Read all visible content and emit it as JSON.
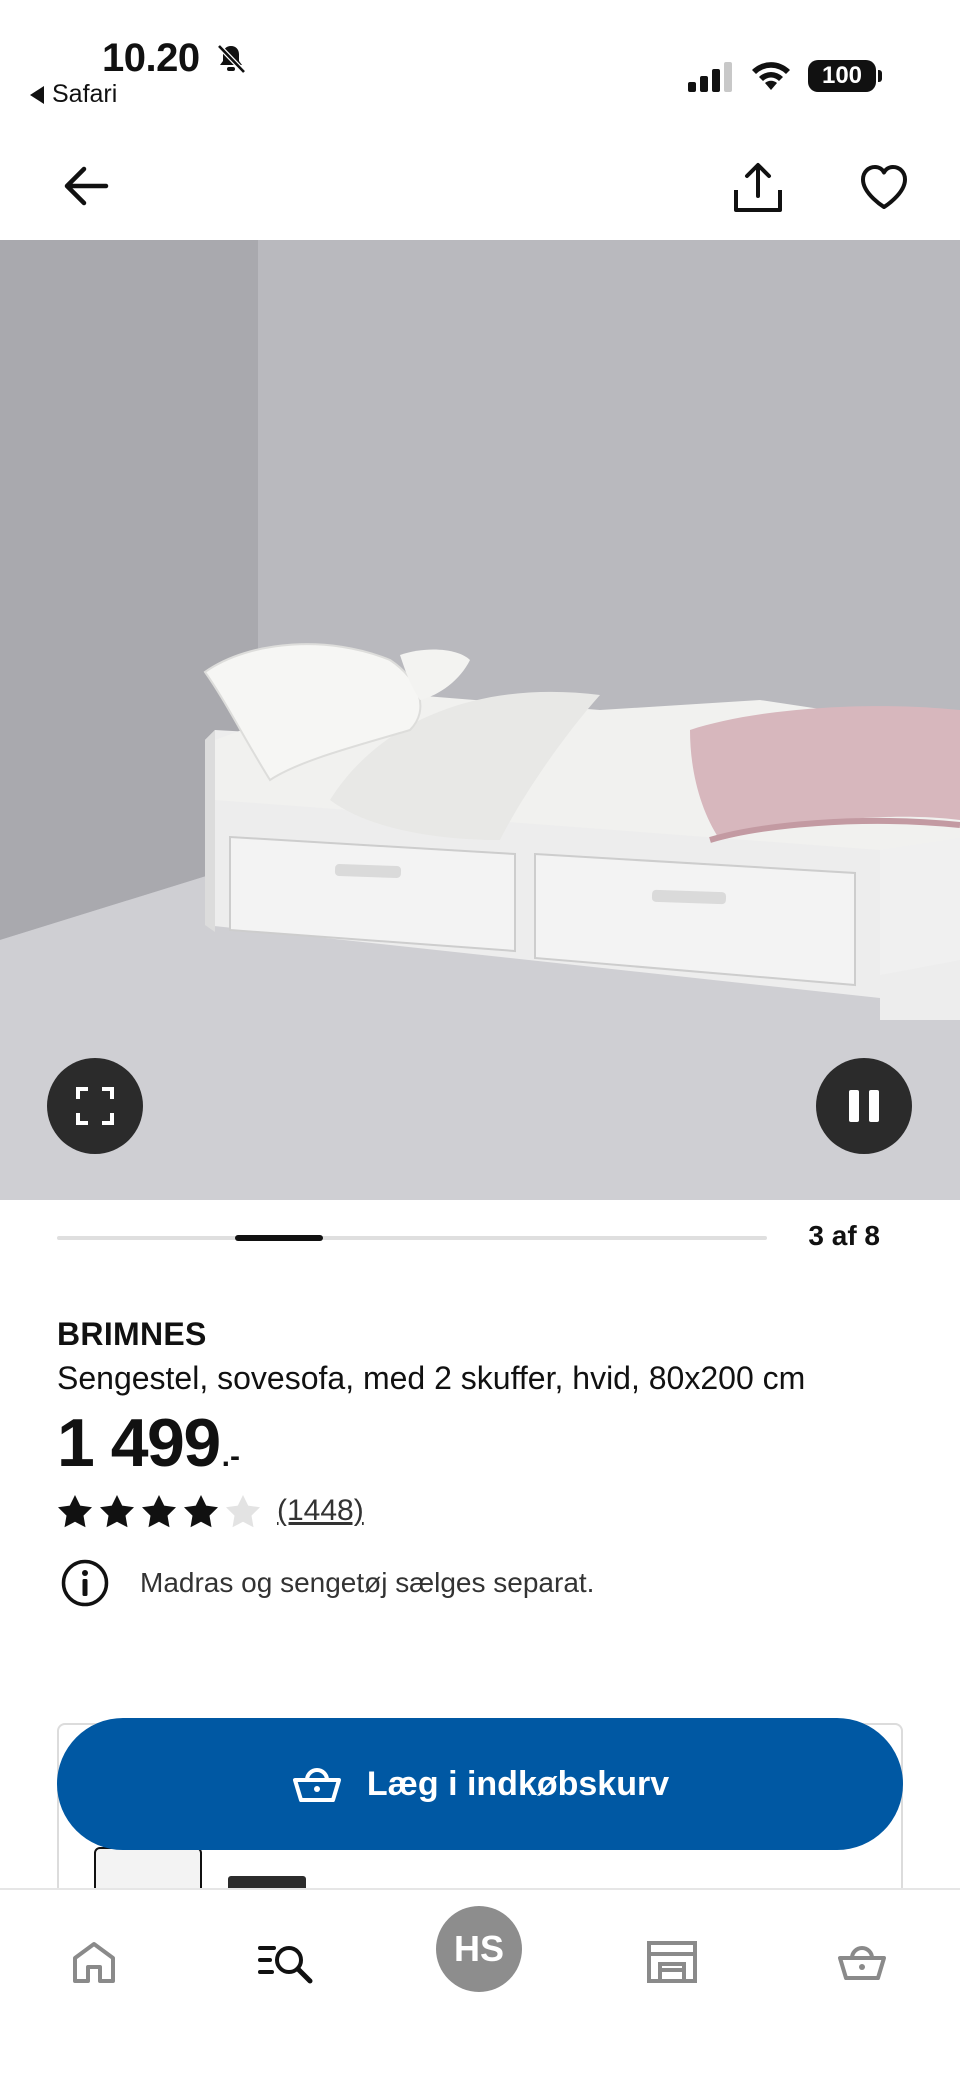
{
  "status_bar": {
    "time": "10.20",
    "back_app": "Safari",
    "battery": "100"
  },
  "nav": {
    "back_icon": "arrow-left-icon",
    "share_icon": "share-icon",
    "favorite_icon": "heart-icon"
  },
  "gallery": {
    "slide_counter": "3 af 8",
    "current_slide": 3,
    "total_slides": 8,
    "fullscreen_icon": "fullscreen-icon",
    "pause_icon": "pause-icon"
  },
  "product": {
    "brand": "BRIMNES",
    "description": "Sengestel, sovesofa, med 2 skuffer, hvid, 80x200 cm",
    "price": "1 499",
    "price_suffix": ".-",
    "rating": 4,
    "rating_max": 5,
    "review_count": "(1448)",
    "notice": "Madras og sengetøj sælges separat."
  },
  "cart": {
    "button_label": "Læg i indkøbskurv",
    "accent_color": "#0058a3"
  },
  "tab_bar": {
    "profile_initials": "HS",
    "items": [
      "home-icon",
      "search-list-icon",
      "profile-avatar",
      "store-icon",
      "basket-icon"
    ]
  }
}
